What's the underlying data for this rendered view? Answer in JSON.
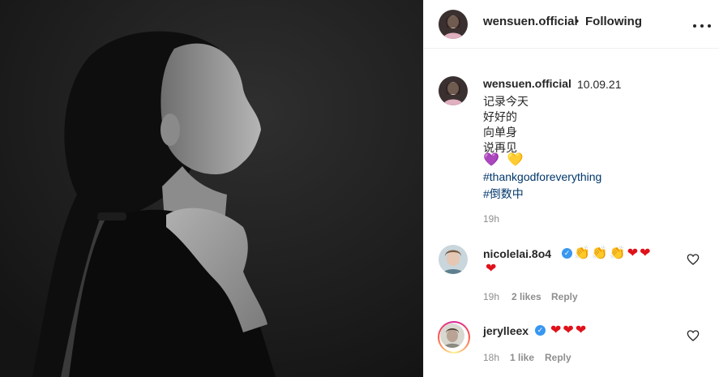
{
  "post": {
    "author": "wensuen.official",
    "separator": "•",
    "follow_label": "Following",
    "more_label": "more-options"
  },
  "caption": {
    "username": "wensuen.official",
    "date": "10.09.21",
    "lines": [
      "记录今天",
      "好好的",
      "向单身",
      "说再见"
    ],
    "emojis": [
      "💜",
      "💛"
    ],
    "hashtags": [
      "#thankgodforeverything",
      "#倒数中"
    ],
    "time": "19h"
  },
  "comments": [
    {
      "username": "nicolelai.8o4",
      "verified": true,
      "emojis_line1": [
        "👏",
        "👏",
        "👏",
        "❤",
        "❤"
      ],
      "emojis_line2": [
        "❤"
      ],
      "time": "19h",
      "likes": "2 likes",
      "reply": "Reply"
    },
    {
      "username": "jerylleex",
      "verified": true,
      "emojis_line1": [
        "❤",
        "❤",
        "❤"
      ],
      "time": "18h",
      "likes": "1 like",
      "reply": "Reply"
    }
  ],
  "icons": {
    "verified": "✓",
    "like_heart": "heart-outline-icon"
  },
  "colors": {
    "text": "#262626",
    "secondary": "#8e8e8e",
    "hashtag": "#00376b",
    "verified": "#3897f0"
  }
}
